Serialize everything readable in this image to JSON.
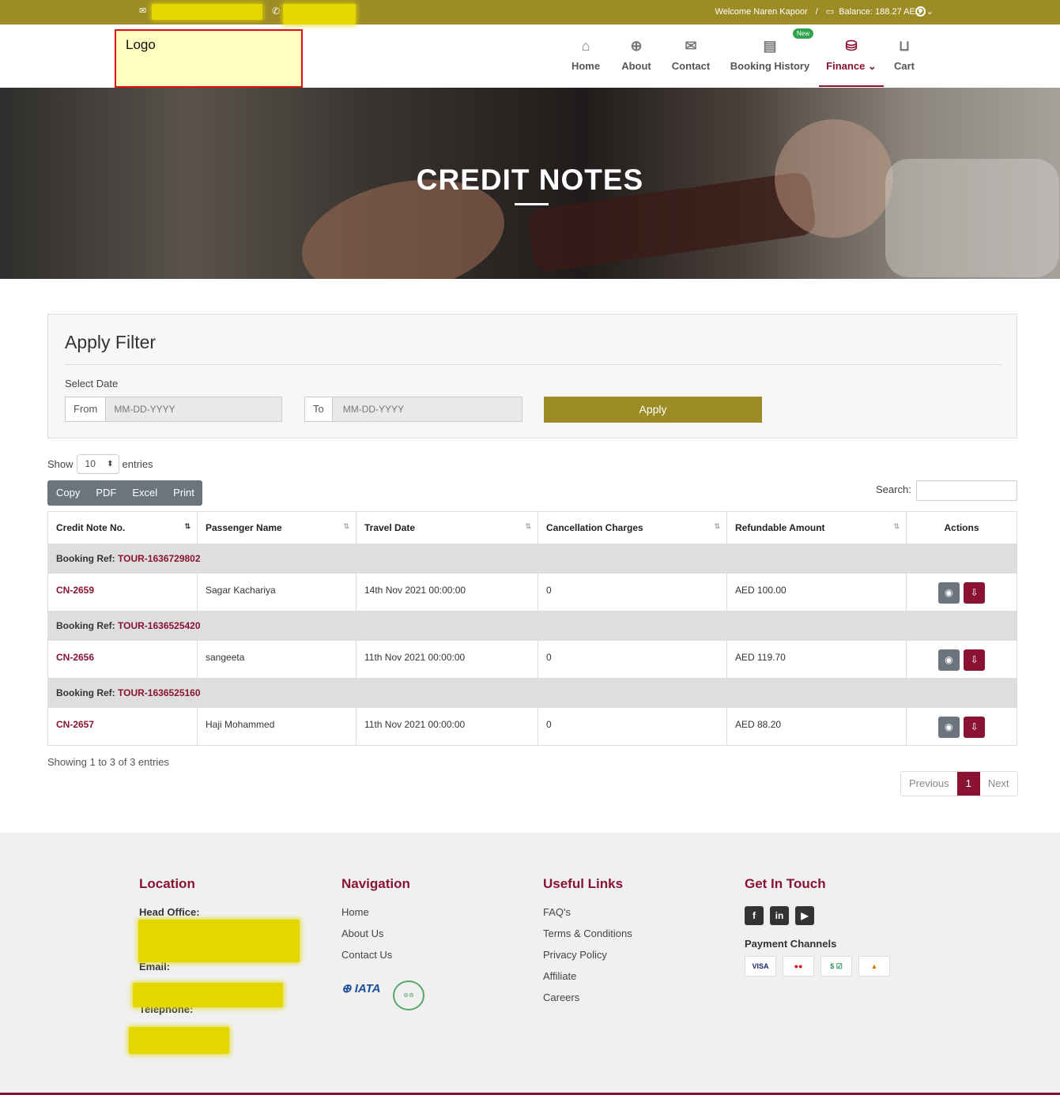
{
  "topbar": {
    "welcome": "Welcome Naren Kapoor",
    "sep": "/",
    "balance": "Balance: 188.27 AED"
  },
  "logo": "Logo",
  "nav": {
    "home": "Home",
    "about": "About",
    "contact": "Contact",
    "booking_history": "Booking History",
    "finance": "Finance",
    "cart": "Cart",
    "new_badge": "New"
  },
  "hero": {
    "title": "CREDIT NOTES"
  },
  "filter": {
    "title": "Apply Filter",
    "select_date": "Select Date",
    "from": "From",
    "to": "To",
    "from_placeholder": "MM-DD-YYYY",
    "to_placeholder": "MM-DD-YYYY",
    "apply": "Apply"
  },
  "table_controls": {
    "show": "Show",
    "entries_value": "10",
    "entries": "entries",
    "copy": "Copy",
    "pdf": "PDF",
    "excel": "Excel",
    "print": "Print",
    "search": "Search:"
  },
  "table": {
    "headers": [
      "Credit Note No.",
      "Passenger Name",
      "Travel Date",
      "Cancellation Charges",
      "Refundable Amount",
      "Actions"
    ],
    "booking_ref_label": "Booking Ref:",
    "groups": [
      {
        "ref": "TOUR-1636729802",
        "cn": "CN-2659",
        "passenger": "Sagar Kachariya",
        "date": "14th Nov 2021 00:00:00",
        "charges": "0",
        "amount": "AED 100.00"
      },
      {
        "ref": "TOUR-1636525420",
        "cn": "CN-2656",
        "passenger": "sangeeta",
        "date": "11th Nov 2021 00:00:00",
        "charges": "0",
        "amount": "AED 119.70"
      },
      {
        "ref": "TOUR-1636525160",
        "cn": "CN-2657",
        "passenger": "Haji Mohammed",
        "date": "11th Nov 2021 00:00:00",
        "charges": "0",
        "amount": "AED 88.20"
      }
    ]
  },
  "info": "Showing 1 to 3 of 3 entries",
  "pager": {
    "prev": "Previous",
    "page": "1",
    "next": "Next"
  },
  "footer": {
    "location": {
      "title": "Location",
      "head_office": "Head Office:",
      "email": "Email:",
      "telephone": "Telephone:"
    },
    "navigation": {
      "title": "Navigation",
      "links": [
        "Home",
        "About Us",
        "Contact Us"
      ]
    },
    "useful": {
      "title": "Useful Links",
      "links": [
        "FAQ's",
        "Terms & Conditions",
        "Privacy Policy",
        "Affiliate",
        "Careers"
      ]
    },
    "touch": {
      "title": "Get In Touch",
      "payment": "Payment Channels"
    }
  },
  "colors": {
    "brand": "#9d8c25",
    "accent": "#8a1333"
  }
}
